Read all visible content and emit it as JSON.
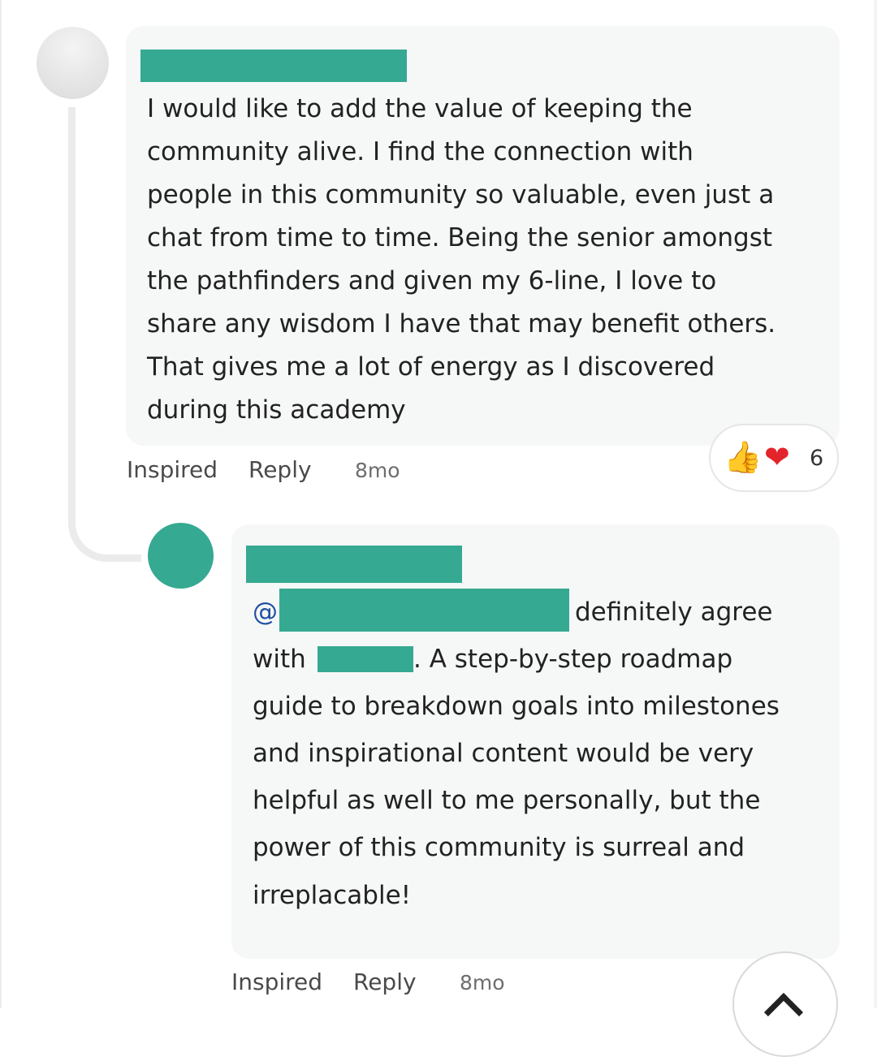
{
  "comments": [
    {
      "author_redacted": true,
      "body_lines": [
        "I would like to add the value of keeping the",
        "community alive.  I find the connection with",
        "people in this community so valuable, even just a",
        "chat from time to time.  Being the senior amongst",
        "the pathfinders and given my 6-line, I love to",
        "share any wisdom I have that may benefit others.",
        "That gives me a lot of energy as I discovered",
        "during this academy"
      ],
      "actions": {
        "inspired": "Inspired",
        "reply": "Reply"
      },
      "time": "8mo",
      "reactions": {
        "icons": [
          "thumbs-up-icon",
          "heart-icon"
        ],
        "count": "6"
      }
    },
    {
      "author_redacted": true,
      "mention_prefix": "@",
      "line1_end": "definitely agree",
      "line2_start": "with",
      "line2_end": ". A step-by-step roadmap",
      "body_lines_rest": [
        "guide to breakdown goals into milestones",
        "and inspirational content would be very",
        "helpful as well to me personally, but the",
        "power of this community is surreal and",
        "irreplacable!"
      ],
      "actions": {
        "inspired": "Inspired",
        "reply": "Reply"
      },
      "time": "8mo"
    }
  ],
  "colors": {
    "redaction": "#35a991",
    "mention": "#1f4fa0",
    "bubble": "#f6f7f7"
  },
  "scroll_top_icon": "chevron-up-icon"
}
